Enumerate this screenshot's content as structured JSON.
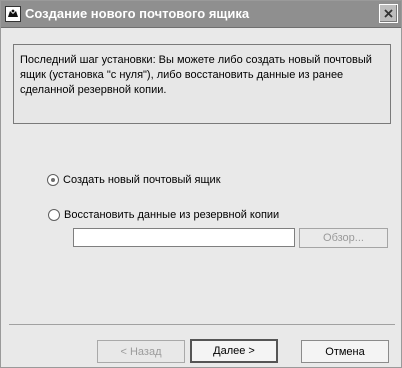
{
  "window": {
    "title": "Создание нового почтового ящика"
  },
  "info": {
    "text": "Последний шаг установки: Вы можете либо создать новый почтовый ящик (установка \"с нуля\"), либо восстановить данные из ранее сделанной резервной копии."
  },
  "options": {
    "create_label": "Создать новый почтовый ящик",
    "restore_label": "Восстановить данные из резервной копии",
    "selected": "create"
  },
  "backup": {
    "path_value": "",
    "browse_label": "Обзор..."
  },
  "footer": {
    "back_label": "< Назад",
    "next_label": "Далее  >",
    "cancel_label": "Отмена"
  }
}
